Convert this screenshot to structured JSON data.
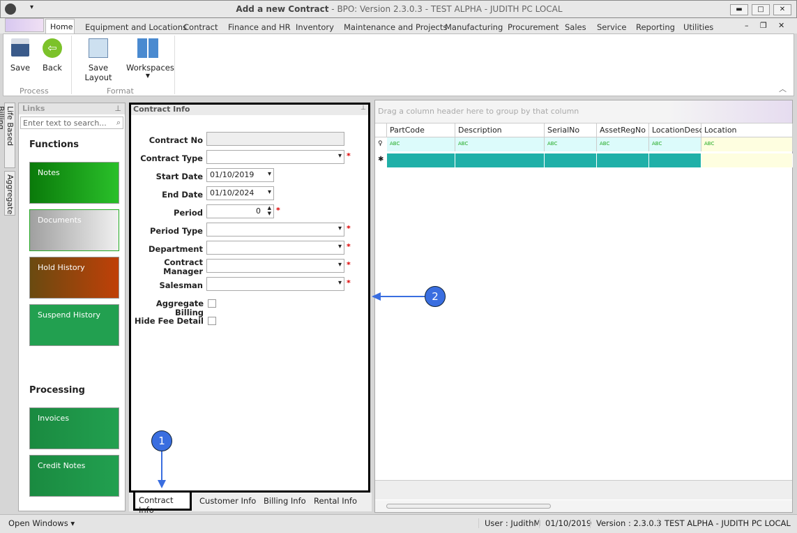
{
  "window": {
    "title_bold": "Add a new Contract",
    "title_rest": " - BPO: Version 2.3.0.3 - TEST ALPHA - JUDITH PC LOCAL"
  },
  "menu_tabs": [
    "Home",
    "Equipment and Locations",
    "Contract",
    "Finance and HR",
    "Inventory",
    "Maintenance and Projects",
    "Manufacturing",
    "Procurement",
    "Sales",
    "Service",
    "Reporting",
    "Utilities"
  ],
  "ribbon": {
    "save": "Save",
    "back": "Back",
    "save_layout": "Save Layout",
    "workspaces": "Workspaces",
    "group_process": "Process",
    "group_format": "Format"
  },
  "side_tabs": [
    "Life Based Billing",
    "Aggregate"
  ],
  "links": {
    "title": "Links",
    "search_placeholder": "Enter text to search...",
    "functions": "Functions",
    "processing": "Processing",
    "tiles": [
      {
        "label": "Notes",
        "color": "#1a9a1a"
      },
      {
        "label": "Documents",
        "color": "#b0b0b0"
      },
      {
        "label": "Hold History",
        "color": "#b04a10"
      },
      {
        "label": "Suspend History",
        "color": "#22a050"
      }
    ],
    "proc_tiles": [
      {
        "label": "Invoices",
        "color": "#22a050"
      },
      {
        "label": "Credit Notes",
        "color": "#22a050"
      }
    ]
  },
  "form": {
    "title": "Contract Info",
    "contract_no": "Contract No",
    "contract_type": "Contract Type",
    "start_date": "Start Date",
    "start_value": "01/10/2019",
    "end_date": "End Date",
    "end_value": "01/10/2024",
    "period": "Period",
    "period_value": "0",
    "period_type": "Period Type",
    "department": "Department",
    "contract_manager": "Contract Manager",
    "salesman": "Salesman",
    "aggregate_billing": "Aggregate Billing",
    "hide_fee_detail": "Hide Fee Detail",
    "required": "*"
  },
  "bottom_tabs": [
    "Contract Info",
    "Customer Info",
    "Billing Info",
    "Rental Info"
  ],
  "grid": {
    "group_hint": "Drag a column header here to group by that column",
    "columns": [
      "PartCode",
      "Description",
      "SerialNo",
      "AssetRegNo",
      "LocationDesc",
      "Location"
    ],
    "filter_glyph": "ABC"
  },
  "status": {
    "open_windows": "Open Windows",
    "user": "User : JudithM",
    "date": "01/10/2019",
    "version": "Version : 2.3.0.3",
    "env": "TEST ALPHA - JUDITH PC LOCAL"
  },
  "callouts": [
    "1",
    "2"
  ]
}
